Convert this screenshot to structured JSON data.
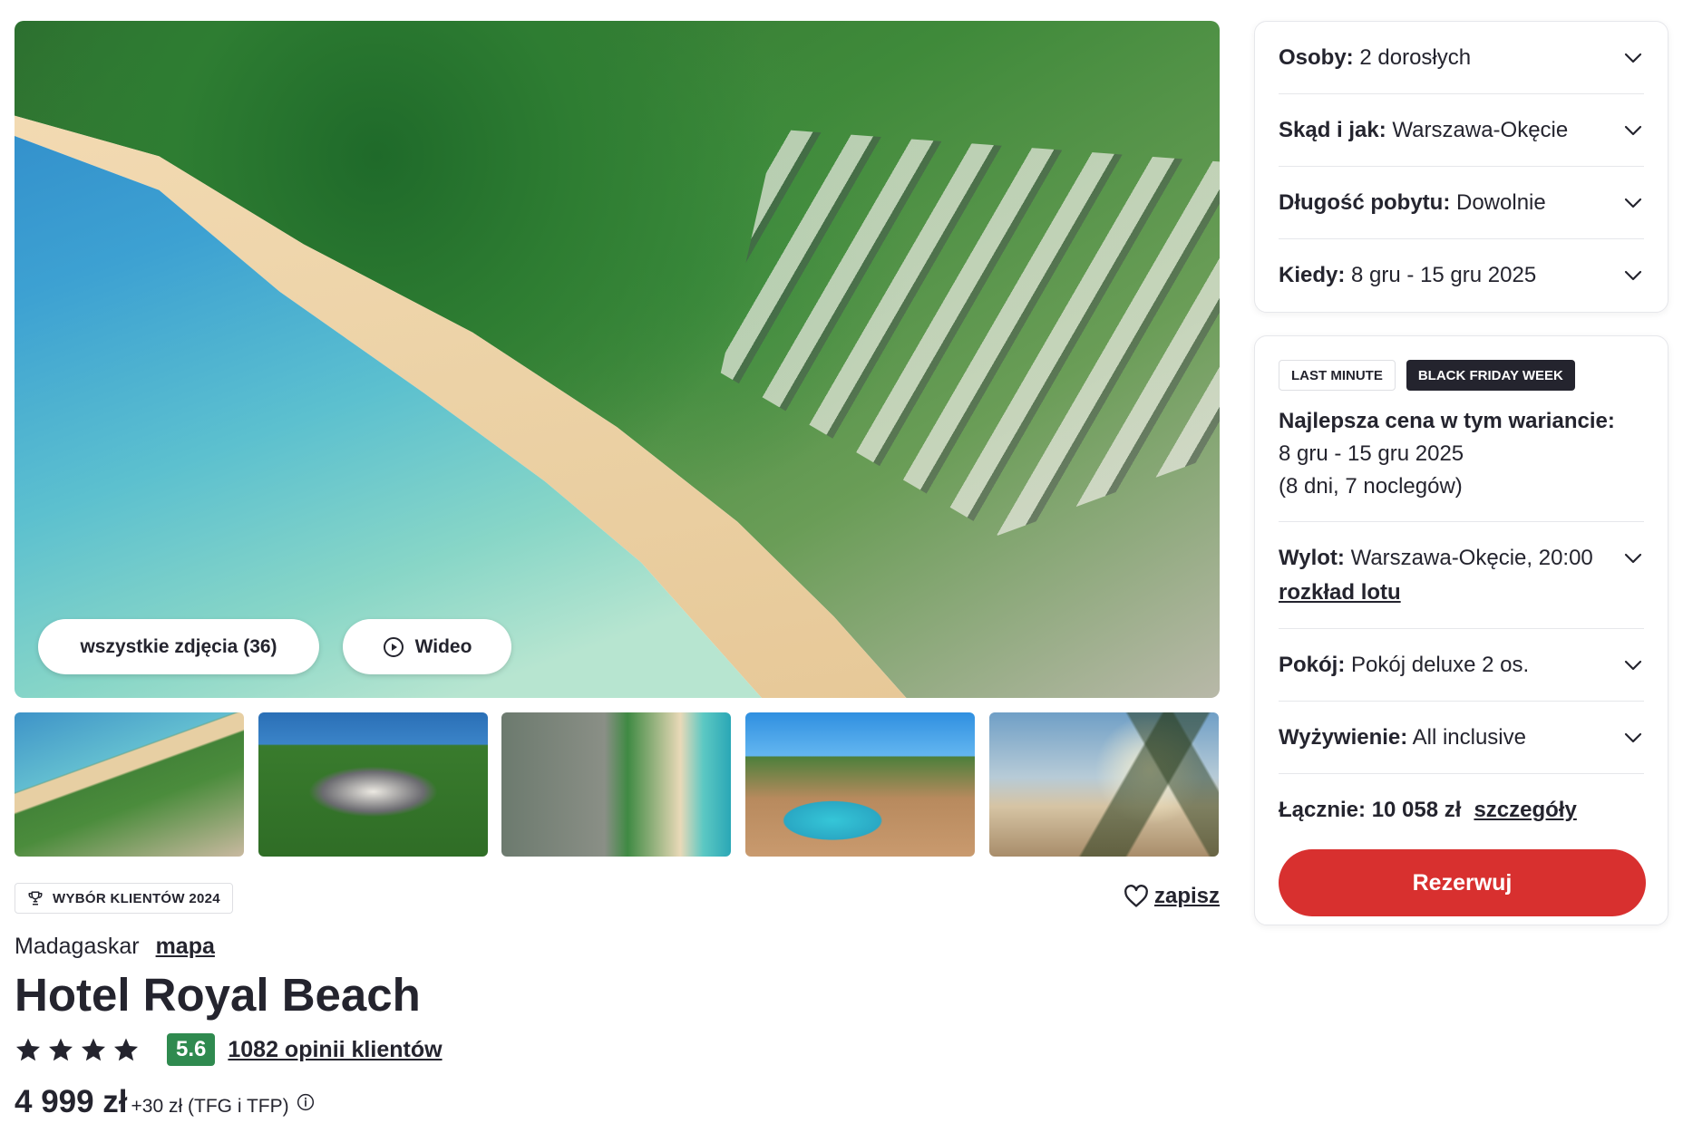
{
  "gallery": {
    "all_photos_label": "wszystkie zdjęcia (36)",
    "video_label": "Wideo",
    "thumbnails": [
      "beach-aerial",
      "hotel-aerial",
      "resort-top-view",
      "pool",
      "beach-palms"
    ]
  },
  "award_badge": "WYBÓR KLIENTÓW 2024",
  "save_label": "zapisz",
  "location": {
    "country": "Madagaskar",
    "map_label": "mapa"
  },
  "hotel_name": "Hotel Royal Beach",
  "rating": {
    "stars": 4,
    "score": "5.6",
    "reviews_label": "1082 opinii klientów",
    "score_color": "#2f8a4f"
  },
  "price": {
    "main": "4 999 zł",
    "extra": "+30 zł (TFG i TFP)"
  },
  "search_panel": {
    "rows": [
      {
        "label": "Osoby:",
        "value": "2 dorosłych"
      },
      {
        "label": "Skąd i jak:",
        "value": "Warszawa-Okęcie"
      },
      {
        "label": "Długość pobytu:",
        "value": "Dowolnie"
      },
      {
        "label": "Kiedy:",
        "value": "8 gru - 15 gru 2025"
      }
    ]
  },
  "offer_panel": {
    "tags": [
      "LAST MINUTE",
      "BLACK FRIDAY WEEK"
    ],
    "best_price_title": "Najlepsza cena w tym wariancie:",
    "dates": "8 gru - 15 gru 2025",
    "duration": "(8 dni, 7 noclegów)",
    "flight": {
      "label": "Wylot:",
      "value": "Warszawa-Okęcie, 20:00",
      "link": "rozkład lotu"
    },
    "room": {
      "label": "Pokój:",
      "value": "Pokój deluxe 2 os."
    },
    "board": {
      "label": "Wyżywienie:",
      "value": "All inclusive"
    },
    "total": {
      "label": "Łącznie: 10 058 zł",
      "details_label": "szczegóły"
    },
    "book_label": "Rezerwuj",
    "accent_color": "#d8302f"
  }
}
